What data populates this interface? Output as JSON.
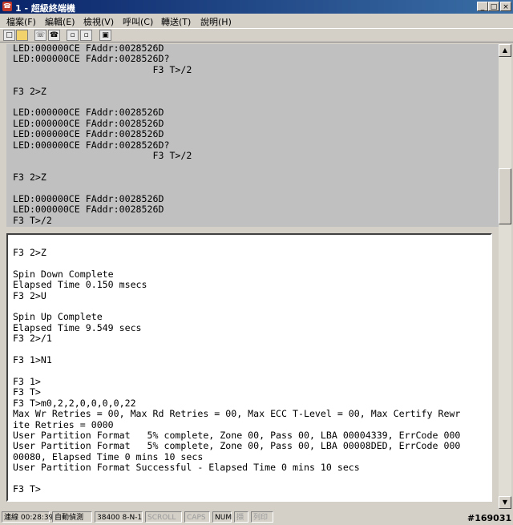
{
  "window": {
    "title": "1 - 超級終端機",
    "minimize": "_",
    "maximize": "□",
    "close": "×"
  },
  "menu": [
    "檔案(F)",
    "編輯(E)",
    "檢視(V)",
    "呼叫(C)",
    "轉送(T)",
    "說明(H)"
  ],
  "toolbar": {
    "new": "new-icon",
    "open": "open-folder-icon",
    "connect": "phone-icon",
    "disconnect": "hangup-icon",
    "send": "send-file-icon",
    "receive": "receive-file-icon",
    "properties": "properties-icon"
  },
  "terminal": {
    "backscroll": [
      "LED:000000CE FAddr:0028526D",
      "LED:000000CE FAddr:0028526D?",
      "                         F3 T>/2",
      "",
      "F3 2>Z",
      "",
      "LED:000000CE FAddr:0028526D",
      "LED:000000CE FAddr:0028526D",
      "LED:000000CE FAddr:0028526D",
      "LED:000000CE FAddr:0028526D?",
      "                         F3 T>/2",
      "",
      "F3 2>Z",
      "",
      "LED:000000CE FAddr:0028526D",
      "LED:000000CE FAddr:0028526D",
      "F3 T>/2"
    ],
    "current": [
      "F3 2>Z",
      "",
      "Spin Down Complete",
      "Elapsed Time 0.150 msecs",
      "F3 2>U",
      "",
      "Spin Up Complete",
      "Elapsed Time 9.549 secs",
      "F3 2>/1",
      "",
      "F3 1>N1",
      "",
      "F3 1>",
      "F3 T>",
      "F3 T>m0,2,2,0,0,0,0,22",
      "Max Wr Retries = 00, Max Rd Retries = 00, Max ECC T-Level = 00, Max Certify Rewr",
      "ite Retries = 0000",
      "User Partition Format   5% complete, Zone 00, Pass 00, LBA 00004339, ErrCode 000",
      "User Partition Format   5% complete, Zone 00, Pass 00, LBA 00008DED, ErrCode 000",
      "00080, Elapsed Time 0 mins 10 secs",
      "User Partition Format Successful - Elapsed Time 0 mins 10 secs",
      "",
      "F3 T>"
    ]
  },
  "status": {
    "connected": "連線 00:28:39",
    "detect": "自動偵測",
    "port": "38400 8-N-1",
    "scroll": "SCROLL",
    "caps": "CAPS",
    "num": "NUM",
    "capture": "擷",
    "echo": "列印"
  },
  "watermark": "#169031"
}
